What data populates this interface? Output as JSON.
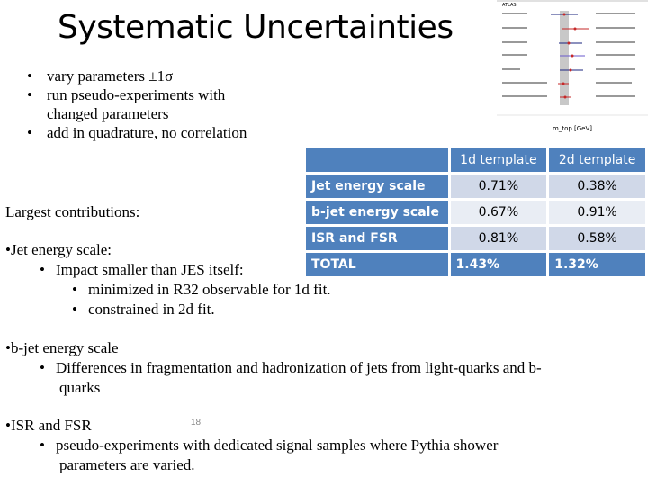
{
  "title": "Systematic Uncertainties",
  "top_bullets": [
    "vary parameters ±1σ",
    "run pseudo-experiments with",
    "changed parameters",
    "add in quadrature, no correlation"
  ],
  "plot": {
    "experiment_label": "ATLAS",
    "xlabel": "m_top [GeV]",
    "point_colors": [
      "#1a237e",
      "#c62828"
    ],
    "band_color": "#c8c8c8"
  },
  "table": {
    "headers": [
      "",
      "1d template",
      "2d template"
    ],
    "rows": [
      {
        "label": "Jet energy scale",
        "d1": "0.71%",
        "d2": "0.38%"
      },
      {
        "label": "b-jet energy scale",
        "d1": "0.67%",
        "d2": "0.91%"
      },
      {
        "label": "ISR and FSR",
        "d1": "0.81%",
        "d2": "0.58%"
      }
    ],
    "total": {
      "label": "TOTAL",
      "d1": "1.43%",
      "d2": "1.32%"
    },
    "accent": "#4f81bd"
  },
  "largest": "Largest contributions:",
  "jes": {
    "head": "•Jet energy scale:",
    "sub": "Impact smaller than JES itself:",
    "subsub": [
      "minimized in R32 observable for 1d fit.",
      "constrained in 2d fit."
    ]
  },
  "bjes": {
    "head": "•b-jet energy scale",
    "sub1": "Differences in fragmentation and hadronization of jets from light-quarks and b-",
    "sub2": "quarks"
  },
  "isr": {
    "head": "•ISR and FSR",
    "sub1": "pseudo-experiments with dedicated signal samples where Pythia shower",
    "sub2": "parameters are varied."
  },
  "page_number": "18"
}
